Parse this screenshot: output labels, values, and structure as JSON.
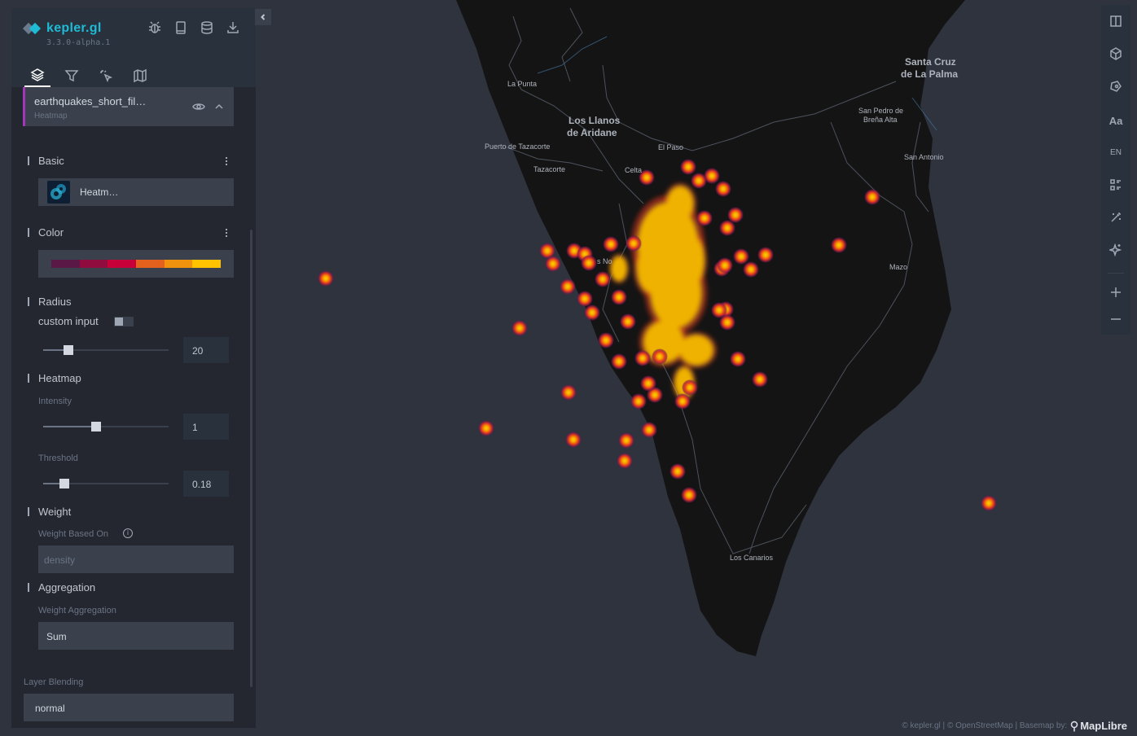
{
  "app": {
    "title": "kepler.gl",
    "version": "3.3.0-alpha.1"
  },
  "header_actions": [
    {
      "name": "bug-report-icon"
    },
    {
      "name": "docs-icon"
    },
    {
      "name": "storage-icon"
    },
    {
      "name": "export-icon"
    }
  ],
  "tabs": [
    {
      "name": "layers-tab",
      "active": true
    },
    {
      "name": "filters-tab",
      "active": false
    },
    {
      "name": "interactions-tab",
      "active": false
    },
    {
      "name": "basemap-tab",
      "active": false
    }
  ],
  "layer": {
    "name": "earthquakes_short_fil…",
    "type": "Heatmap",
    "accent": "#a238b9"
  },
  "basic": {
    "title": "Basic",
    "layer_type_label": "Heatm…"
  },
  "color": {
    "title": "Color",
    "palette": [
      "#5a1846",
      "#900c3f",
      "#c70039",
      "#e3611c",
      "#f1920e",
      "#ffc300"
    ]
  },
  "radius": {
    "title": "Radius",
    "custom_input_label": "custom input",
    "custom_input_on": false,
    "value": "20",
    "slider_fraction": 0.2
  },
  "heatmap": {
    "title": "Heatmap",
    "intensity_label": "Intensity",
    "intensity_value": "1",
    "intensity_fraction": 0.42,
    "threshold_label": "Threshold",
    "threshold_value": "0.18",
    "threshold_fraction": 0.17
  },
  "weight": {
    "title": "Weight",
    "based_on_label": "Weight Based On",
    "based_on_value": "density"
  },
  "aggregation": {
    "title": "Aggregation",
    "weight_aggregation_label": "Weight Aggregation",
    "weight_aggregation_value": "Sum"
  },
  "layer_blending": {
    "label": "Layer Blending",
    "value": "normal"
  },
  "map_controls": [
    {
      "name": "split-map-icon"
    },
    {
      "name": "3d-view-icon"
    },
    {
      "name": "draw-polygon-icon"
    },
    {
      "name": "map-legend-text",
      "text": "Aa"
    },
    {
      "name": "locale-toggle",
      "text": "EN"
    },
    {
      "name": "layer-legend-icon"
    },
    {
      "name": "effects-icon"
    },
    {
      "name": "ai-assistant-icon"
    },
    {
      "name": "zoom-in-icon"
    },
    {
      "name": "zoom-out-icon"
    }
  ],
  "map": {
    "place_labels": [
      "La Punta",
      "Los Llanos\nde Aridane",
      "Puerto de Tazacorte",
      "Tazacorte",
      "Celta",
      "El Paso",
      "Santa Cruz\nde La Palma",
      "San Pedro de\nBreña Alta",
      "San Antonio",
      "Mazo",
      "Los Canarios",
      "s No"
    ],
    "heat_colors": {
      "core": "#f0b200",
      "mid": "#e63a1e",
      "outer": "#8c1a4a"
    }
  },
  "attribution": {
    "text": "© kepler.gl | © OpenStreetMap | Basemap by:",
    "brand": "MapLibre"
  }
}
